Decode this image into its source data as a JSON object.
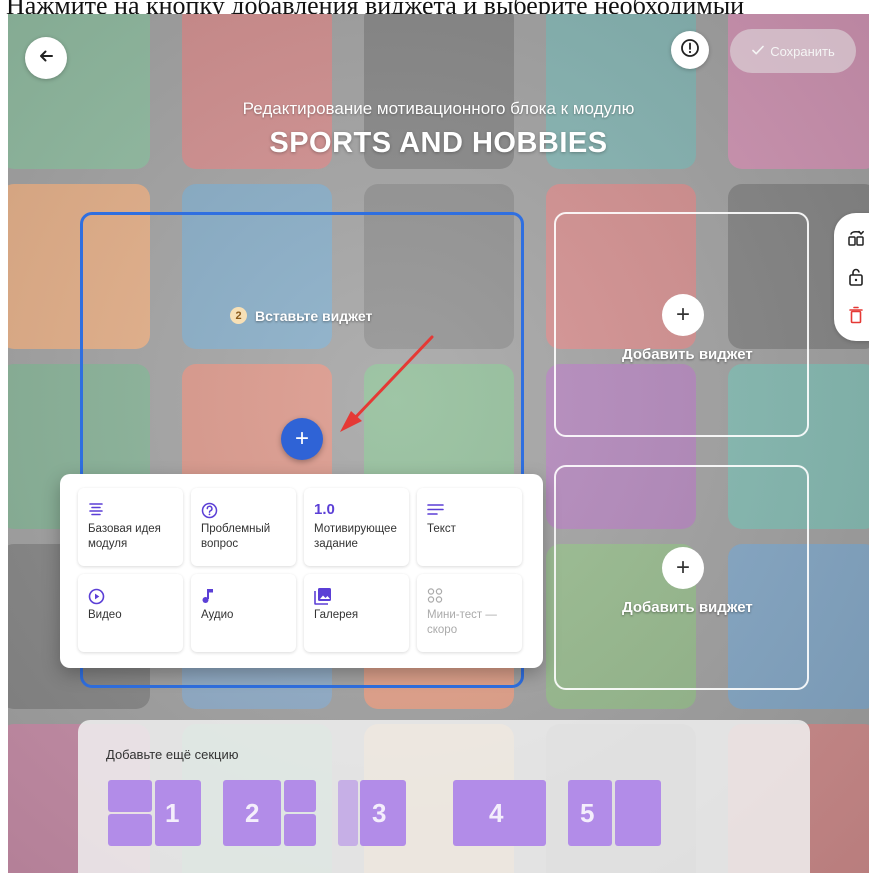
{
  "caption": "Нажмите на кнопку добавления виджета и выберите необходимый",
  "header": {
    "save_label": "Сохранить",
    "subtitle": "Редактирование мотивационного блока к модулю",
    "title": "SPORTS AND HOBBIES"
  },
  "hint": {
    "number": "2",
    "text": "Вставьте виджет"
  },
  "slots": {
    "add_label": "Добавить виджет",
    "add_symbol": "+"
  },
  "widget_menu": {
    "items": [
      {
        "label": "Базовая идея модуля",
        "icon": "list-center-icon",
        "enabled": true
      },
      {
        "label": "Проблемный вопрос",
        "icon": "question-circle-icon",
        "enabled": true
      },
      {
        "label": "Мотивирующее задание",
        "icon": "1.0",
        "enabled": true
      },
      {
        "label": "Текст",
        "icon": "text-lines-icon",
        "enabled": true
      },
      {
        "label": "Видео",
        "icon": "play-circle-icon",
        "enabled": true
      },
      {
        "label": "Аудио",
        "icon": "music-note-icon",
        "enabled": true
      },
      {
        "label": "Галерея",
        "icon": "gallery-icon",
        "enabled": true
      },
      {
        "label": "Мини-тест — скоро",
        "icon": "dots-grid-icon",
        "enabled": false
      }
    ]
  },
  "sections": {
    "label": "Добавьте ещё секцию",
    "options": [
      "1",
      "2",
      "3",
      "4",
      "5"
    ]
  },
  "toolbar": {
    "items": [
      "swap-icon",
      "lock-icon",
      "trash-icon"
    ]
  },
  "colors": {
    "accent_blue": "#2f63d6",
    "widget_icon": "#5b3fd6",
    "layout_purple": "#b28ce8",
    "delete_red": "#e53935"
  }
}
